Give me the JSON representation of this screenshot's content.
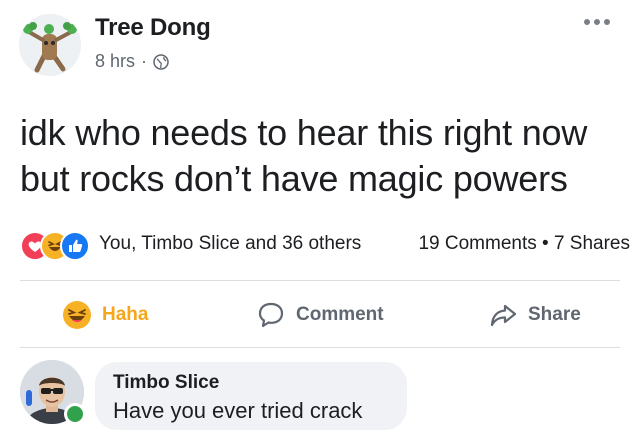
{
  "post": {
    "author": "Tree Dong",
    "time": "8 hrs",
    "separator": "·",
    "audience_icon": "globe-icon",
    "menu_icon": "more-options-icon",
    "text_line1": "idk who needs to hear this right now",
    "text_line2": "but rocks don’t have magic powers"
  },
  "reactions": {
    "icons": [
      "love-reaction-icon",
      "haha-reaction-icon",
      "like-reaction-icon"
    ],
    "names": "You, Timbo Slice and 36 others",
    "counts": "19 Comments • 7 Shares"
  },
  "actions": {
    "haha": "Haha",
    "comment": "Comment",
    "share": "Share"
  },
  "comment": {
    "author": "Timbo Slice",
    "text": "Have you ever tried crack",
    "online": true
  },
  "colors": {
    "love": "#f33e58",
    "haha": "#f7b125",
    "like": "#1877f2",
    "online": "#31a24c",
    "bubble": "#f0f2f5"
  }
}
